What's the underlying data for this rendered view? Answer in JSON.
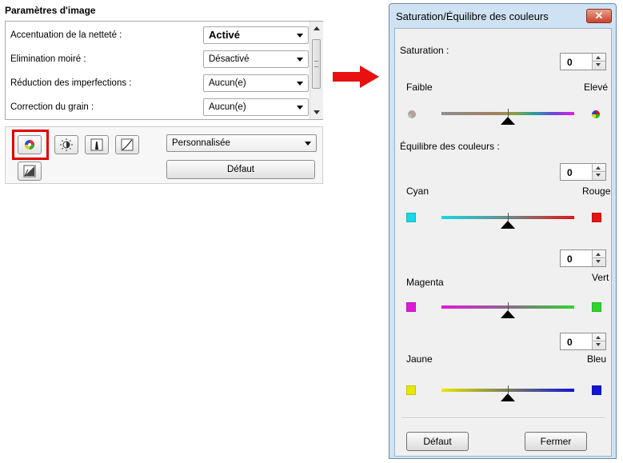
{
  "left_panel": {
    "title": "Paramètres d'image",
    "settings": [
      {
        "label": "Accentuation de la netteté :",
        "value": "Activé"
      },
      {
        "label": "Elimination moiré :",
        "value": "Désactivé"
      },
      {
        "label": "Réduction des imperfections :",
        "value": "Aucun(e)"
      },
      {
        "label": "Correction du grain :",
        "value": "Aucun(e)"
      }
    ],
    "toolbar": {
      "buttons": [
        "saturation-color-balance-icon",
        "brightness-contrast-icon",
        "histogram-icon",
        "tone-curve-icon",
        "threshold-icon"
      ],
      "preset_value": "Personnalisée",
      "default_label": "Défaut"
    }
  },
  "dialog": {
    "title": "Saturation/Équilibre des couleurs",
    "close_label": "✕",
    "saturation": {
      "label": "Saturation :",
      "value": "0",
      "low_label": "Faible",
      "high_label": "Elevé",
      "level": 0.5
    },
    "color_balance": {
      "label": "Équilibre des couleurs :",
      "sliders": [
        {
          "value": "0",
          "left_label": "Cyan",
          "right_label": "Rouge",
          "left_color": "#17d8e3",
          "right_color": "#e31515",
          "level": 0.5
        },
        {
          "value": "0",
          "left_label": "Magenta",
          "right_label": "Vert",
          "left_color": "#e019d8",
          "right_color": "#2ed52e",
          "level": 0.5
        },
        {
          "value": "0",
          "left_label": "Jaune",
          "right_label": "Bleu",
          "left_color": "#e8e800",
          "right_color": "#1515d8",
          "level": 0.5
        }
      ]
    },
    "default_label": "Défaut",
    "close_button_label": "Fermer"
  },
  "colors": {
    "highlight": "#e00000",
    "arrow": "#e81010",
    "dialog_frame": "#cfe2f3"
  }
}
